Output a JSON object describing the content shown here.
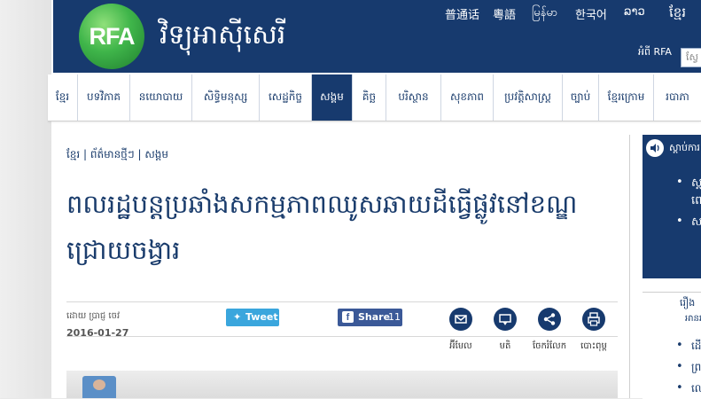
{
  "header": {
    "logo_text": "RFA",
    "site_title": "វិទ្យុអាស៊ីសេរី",
    "languages": [
      "普通话",
      "粵語",
      "မြန်မာ",
      "한국어",
      "ລາວ",
      "ខ្មែរ"
    ],
    "about_link": "អំពី RFA",
    "search_placeholder": "ស្វែ"
  },
  "nav": {
    "items": [
      "ខ្មែរ",
      "បទវិភាគ",
      "នយោបាយ",
      "សិទ្ធិមនុស្ស",
      "សេដ្ឋកិច្ច",
      "សង្គម",
      "គិច្ឆ",
      "បរិស្ថាន",
      "សុខភាព",
      "ប្រវត្តិសាស្ត្រ",
      "ច្បាប់",
      "ខ្មែរក្រោម",
      "របាភា"
    ],
    "active": "សង្គម"
  },
  "article": {
    "breadcrumb": "ខ្មែរ | ព័ត៌មានថ្មីៗ | សង្គម",
    "headline": "ពលរដ្ឋបន្តប្រឆាំងសកម្មភាពឈូសឆាយដីធ្វើផ្លូវនៅខណ្ឌជ្រោយចង្វារ",
    "byline": "ដោយ ប្រាជ្ញ ចេវ",
    "date": "2016-01-27",
    "tweet_label": "Tweet",
    "share_label": "Share",
    "share_count": "11",
    "tools": [
      {
        "icon": "email-icon",
        "label": "អ៊ីមែល"
      },
      {
        "icon": "comment-icon",
        "label": "មតិ"
      },
      {
        "icon": "share-icon",
        "label": "ចែករំលែក"
      },
      {
        "icon": "print-icon",
        "label": "បោះពុម្ព"
      }
    ]
  },
  "sidebar": {
    "listen_title": "ស្ដាប់ការ",
    "listen_items": [
      "ស្ត",
      "សា"
    ],
    "listen_line2": "ពេ",
    "box2_title": "រឿង",
    "box2_sub": "អានរ",
    "box2_items": [
      "ដើមប",
      "ព្រះស",
      "លោក"
    ]
  },
  "colors": {
    "brand_navy": "#173a6e",
    "logo_green": "#3fb54a",
    "twitter_blue": "#3aa6dd",
    "facebook_blue": "#3b5998"
  }
}
